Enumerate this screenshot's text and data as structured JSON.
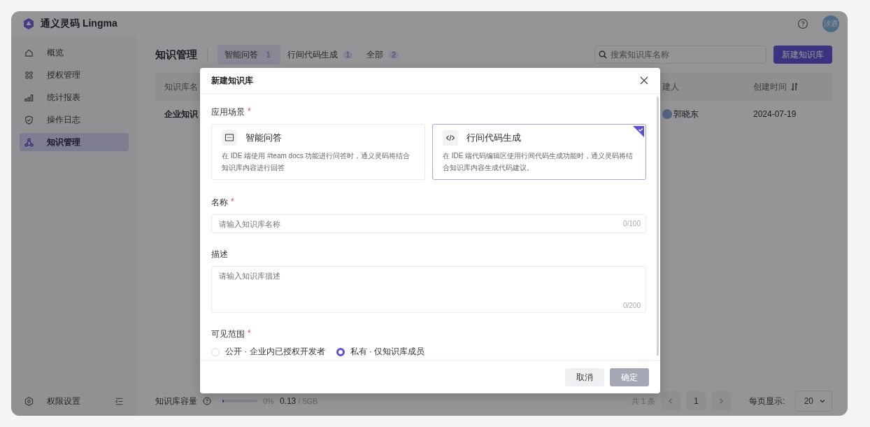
{
  "app": {
    "title": "通义灵码 Lingma",
    "avatar": "汐遇"
  },
  "sidebar": {
    "items": [
      {
        "label": "概览",
        "kind": "home",
        "selected": false
      },
      {
        "label": "授权管理",
        "kind": "grid",
        "selected": false
      },
      {
        "label": "统计报表",
        "kind": "bars",
        "selected": false
      },
      {
        "label": "操作日志",
        "kind": "shield",
        "selected": false
      },
      {
        "label": "知识管理",
        "kind": "nodes",
        "selected": true
      }
    ],
    "footer_item": "权限设置"
  },
  "page": {
    "title": "知识管理",
    "tabs": [
      {
        "label": "智能问答",
        "count": "1",
        "selected": true
      },
      {
        "label": "行间代码生成",
        "count": "1",
        "selected": false
      },
      {
        "label": "全部",
        "count": "2",
        "selected": false
      }
    ],
    "search": {
      "placeholder": "搜索知识库名称"
    },
    "new_button": "新建知识库"
  },
  "table": {
    "columns": [
      "知识库名",
      "建人",
      "创建时间"
    ],
    "rows": [
      {
        "name": "企业知识",
        "creator": "郭晓东",
        "created": "2024-07-19"
      }
    ]
  },
  "footer": {
    "capacity_label": "知识库容量",
    "level": 0,
    "percent": "0%",
    "used": "0.13",
    "total": " / 5GB",
    "total_count": "共 1 条",
    "page": "1",
    "page_size_label": "每页显示:",
    "page_size": "20"
  },
  "dialog": {
    "title": "新建知识库",
    "scene": {
      "label": "应用场景",
      "required_mark": "*",
      "options": [
        {
          "title": "智能问答",
          "kind": "chat",
          "description": "在 IDE 端使用 #team docs 功能进行问答时，通义灵码将结合知识库内容进行回答",
          "selected": false
        },
        {
          "title": "行间代码生成",
          "kind": "code",
          "description": "在 IDE 端代码编辑区使用行间代码生成功能时，通义灵码将结合知识库内容生成代码建议。",
          "selected": true
        }
      ]
    },
    "name": {
      "label": "名称",
      "required_mark": "*",
      "placeholder": "请输入知识库名称",
      "counter": "0/100"
    },
    "description": {
      "label": "描述",
      "placeholder": "请输入知识库描述",
      "counter": "0/200"
    },
    "visibility": {
      "label": "可见范围",
      "required_mark": "*",
      "options": [
        {
          "label": "公开 · 企业内已授权开发者",
          "selected": false
        },
        {
          "label": "私有 · 仅知识库成员",
          "selected": true
        }
      ]
    },
    "cancel": "取消",
    "confirm": {
      "label": "确定",
      "disabled": true
    }
  }
}
